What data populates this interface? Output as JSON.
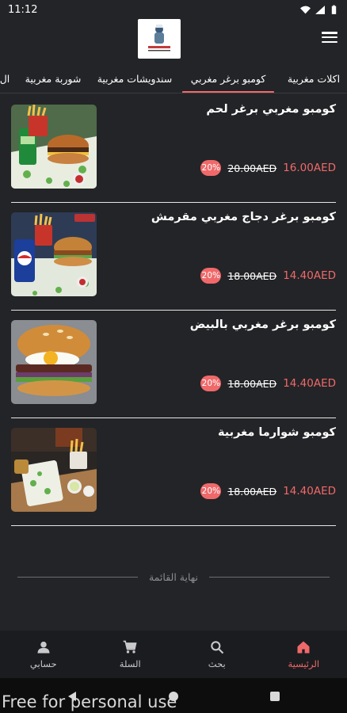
{
  "status_bar": {
    "time": "11:12"
  },
  "header": {
    "logo_icon": "restaurant-logo",
    "menu_icon": "hamburger-menu-icon"
  },
  "tabs": [
    {
      "label": "اكلات مغربية"
    },
    {
      "label": "كومبو برغر مغربي"
    },
    {
      "label": "سندويشات مغربية"
    },
    {
      "label": "شوربة مغربية"
    },
    {
      "label": "ال"
    }
  ],
  "active_tab": "كومبو برغر مغربي",
  "items": [
    {
      "name": "كومبو مغربي برغر لحم",
      "old_price": "20.00AED",
      "new_price": "16.00AED",
      "discount": "20%"
    },
    {
      "name": "كومبو برغر دجاج مغربي مقرمش",
      "old_price": "18.00AED",
      "new_price": "14.40AED",
      "discount": "20%"
    },
    {
      "name": "كومبو برغر مغربي بالبيض",
      "old_price": "18.00AED",
      "new_price": "14.40AED",
      "discount": "20%"
    },
    {
      "name": "كومبو شوارما مغربية",
      "old_price": "18.00AED",
      "new_price": "14.40AED",
      "discount": "20%"
    }
  ],
  "end_of_list": "نهاية القائمة",
  "bottom_nav": [
    {
      "label": "الرئيسية",
      "icon": "home-icon",
      "active": true
    },
    {
      "label": "بحث",
      "icon": "search-icon",
      "active": false
    },
    {
      "label": "السلة",
      "icon": "cart-icon",
      "active": false
    },
    {
      "label": "حسابي",
      "icon": "person-icon",
      "active": false
    }
  ],
  "watermark": "Free for personal use",
  "colors": {
    "background": "#232427",
    "accent": "#f0696a",
    "nav_bg": "#1b1c1f"
  }
}
